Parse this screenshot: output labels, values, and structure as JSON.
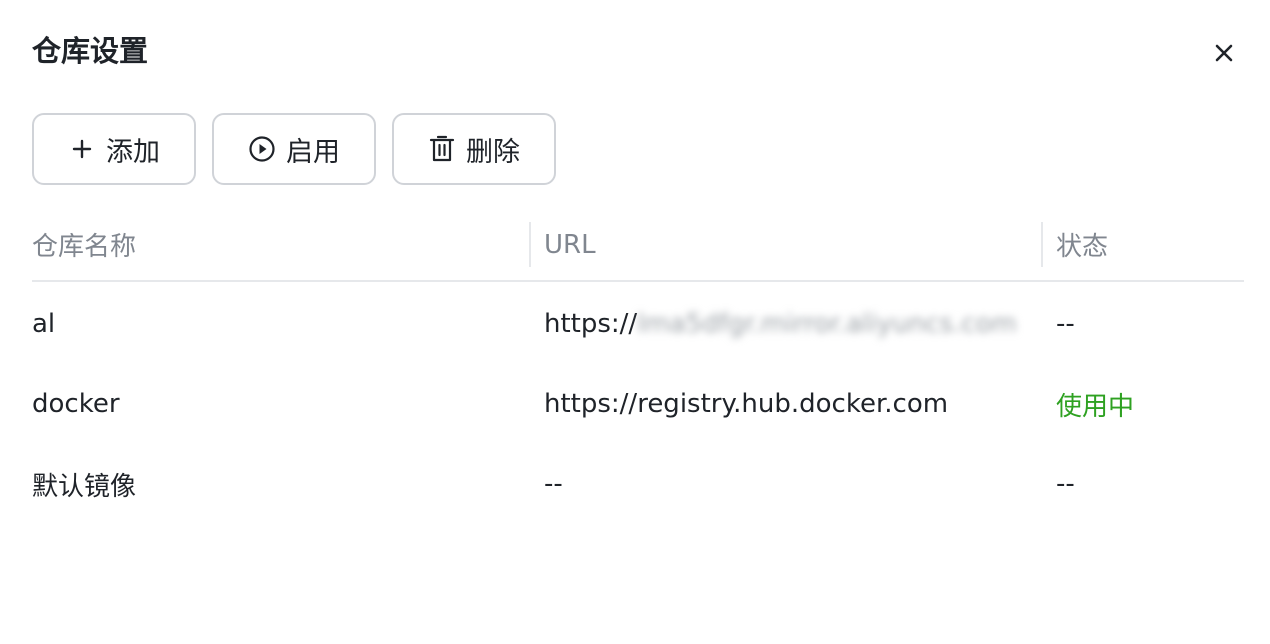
{
  "dialog": {
    "title": "仓库设置"
  },
  "toolbar": {
    "add_label": "添加",
    "enable_label": "启用",
    "delete_label": "删除"
  },
  "table": {
    "columns": [
      "仓库名称",
      "URL",
      "状态"
    ],
    "rows": [
      {
        "name": "al",
        "url_prefix": "https://",
        "url_rest": "lma5dfgr.mirror.aliyuncs.com",
        "status": "--"
      },
      {
        "name": "docker",
        "url": "https://registry.hub.docker.com",
        "status": "使用中"
      },
      {
        "name": "默认镜像",
        "url": "--",
        "status": "--"
      }
    ]
  },
  "colors": {
    "active_status": "#2ea121",
    "text": "#1f2329",
    "header_text": "#80868f",
    "border": "#d0d3d8"
  },
  "icons": {
    "close": "close-icon",
    "add": "plus-icon",
    "enable": "play-circle-icon",
    "delete": "trash-icon"
  }
}
